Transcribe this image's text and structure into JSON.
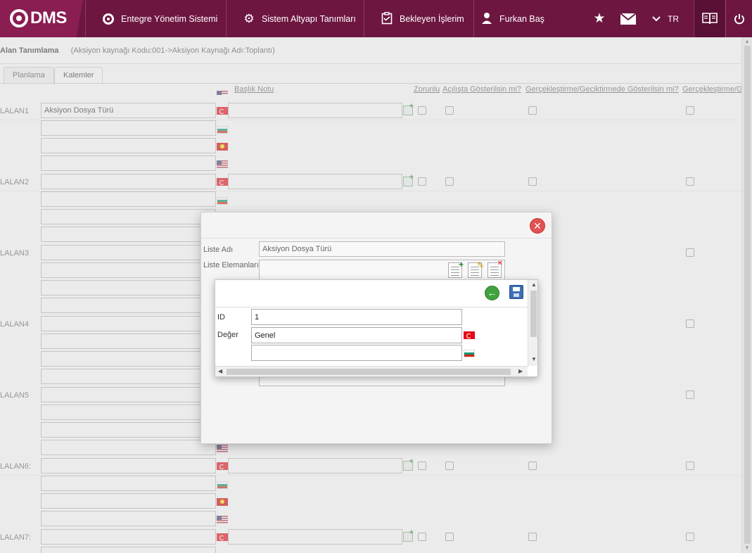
{
  "topbar": {
    "logo_text": "DMS",
    "nav": [
      {
        "label": "Entegre Yönetim Sistemi",
        "icon": "qdms-circle-icon"
      },
      {
        "label": "Sistem Altyapı Tanımları",
        "icon": "gear-icon"
      },
      {
        "label": "Bekleyen İşlerim",
        "icon": "clipboard-icon"
      },
      {
        "label": "Furkan Baş",
        "icon": "user-icon"
      }
    ],
    "icons": [
      "star-icon",
      "mail-icon",
      "chevron-down-icon",
      "book-icon",
      "power-icon"
    ],
    "language": "TR"
  },
  "breadcrumb": {
    "title": "Alan Tanımlama",
    "detail": "(Aksiyon kaynağı Kodu:001->Aksiyon Kaynağı Adı:Toplantı)"
  },
  "tabs": [
    {
      "label": "Planlama",
      "active": false
    },
    {
      "label": "Kalemler",
      "active": true
    }
  ],
  "columns": {
    "baslik_notu": "Başlık Notu",
    "zorunlu": "Zorunlu",
    "acilista": "Açılışta Gösterilsin mi?",
    "gerceklestirme": "Gerçekleştirme/Geciktirmede Gösterilsin mi?",
    "gerceklestirme2": "Gerçekleştirme/G"
  },
  "rows": [
    {
      "label": "LALAN1",
      "value": "Aksiyon Dosya Türü"
    },
    {
      "label": "LALAN2",
      "value": ""
    },
    {
      "label": "LALAN3",
      "value": ""
    },
    {
      "label": "LALAN4",
      "value": ""
    },
    {
      "label": "LALAN5",
      "value": ""
    },
    {
      "label": "LALAN6:",
      "value": ""
    },
    {
      "label": "LALAN7:",
      "value": ""
    }
  ],
  "modal_list": {
    "close_icon": "close-icon",
    "liste_adi_label": "Liste Adı",
    "liste_adi_value": "Aksiyon Dosya Türü",
    "liste_elemanlari_label": "Liste Elemanları",
    "toolbar": [
      "add-icon",
      "edit-icon",
      "delete-icon"
    ]
  },
  "modal_item": {
    "back_icon": "back-arrow-icon",
    "save_icon": "save-icon",
    "id_label": "ID",
    "id_value": "1",
    "deger_label": "Değer",
    "deger_value": "Genel",
    "deger_value_2": ""
  },
  "colors": {
    "topbar": "#6d1640",
    "logo_bg": "#8a1d52",
    "close_red": "#e05252",
    "back_green": "#3fa33f",
    "save_blue": "#3b6fb5"
  }
}
